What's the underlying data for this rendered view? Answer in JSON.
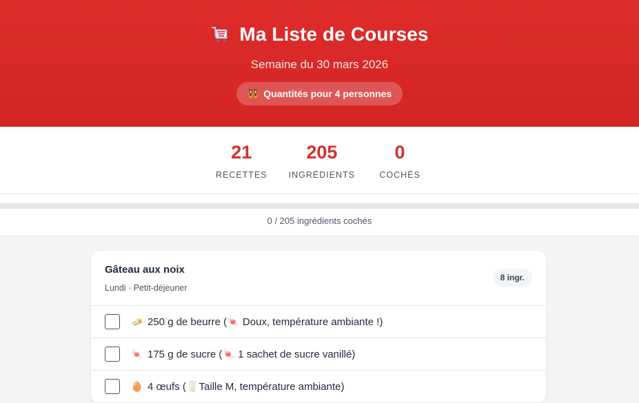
{
  "header": {
    "icon": "shopping-cart-icon",
    "title": "Ma Liste de Courses",
    "subtitle": "Semaine du 30 mars 2026",
    "badge_icon": "people-icon",
    "badge_text": "Quantités pour 4 personnes",
    "color": "#d42525"
  },
  "stats": [
    {
      "value": "21",
      "label": "RECETTES"
    },
    {
      "value": "205",
      "label": "INGRÉDIENTS"
    },
    {
      "value": "0",
      "label": "COCHÉS"
    }
  ],
  "progress": {
    "text": "0 / 205 ingrédients cochés",
    "fraction": 0
  },
  "recipe": {
    "name": "Gâteau aux noix",
    "meta": "Lundi · Petit-déjeuner",
    "count": "8 ingr.",
    "items": [
      {
        "icon": "butter-icon",
        "glyph": "🧈",
        "text": "250 g de beurre (",
        "note_icon": "candy-icon",
        "note_glyph": "🍬",
        "note": " Doux, température ambiante !)"
      },
      {
        "icon": "candy-icon",
        "glyph": "🍬",
        "text": "175 g de sucre (",
        "note_icon": "candy-icon",
        "note_glyph": "🍬",
        "note": " 1 sachet de sucre vanillé)"
      },
      {
        "icon": "egg-icon",
        "glyph": "🥚",
        "text": "4 œufs (",
        "note_icon": "milk-icon",
        "note_glyph": "🥛",
        "note": "Taille M, température ambiante)"
      }
    ]
  }
}
